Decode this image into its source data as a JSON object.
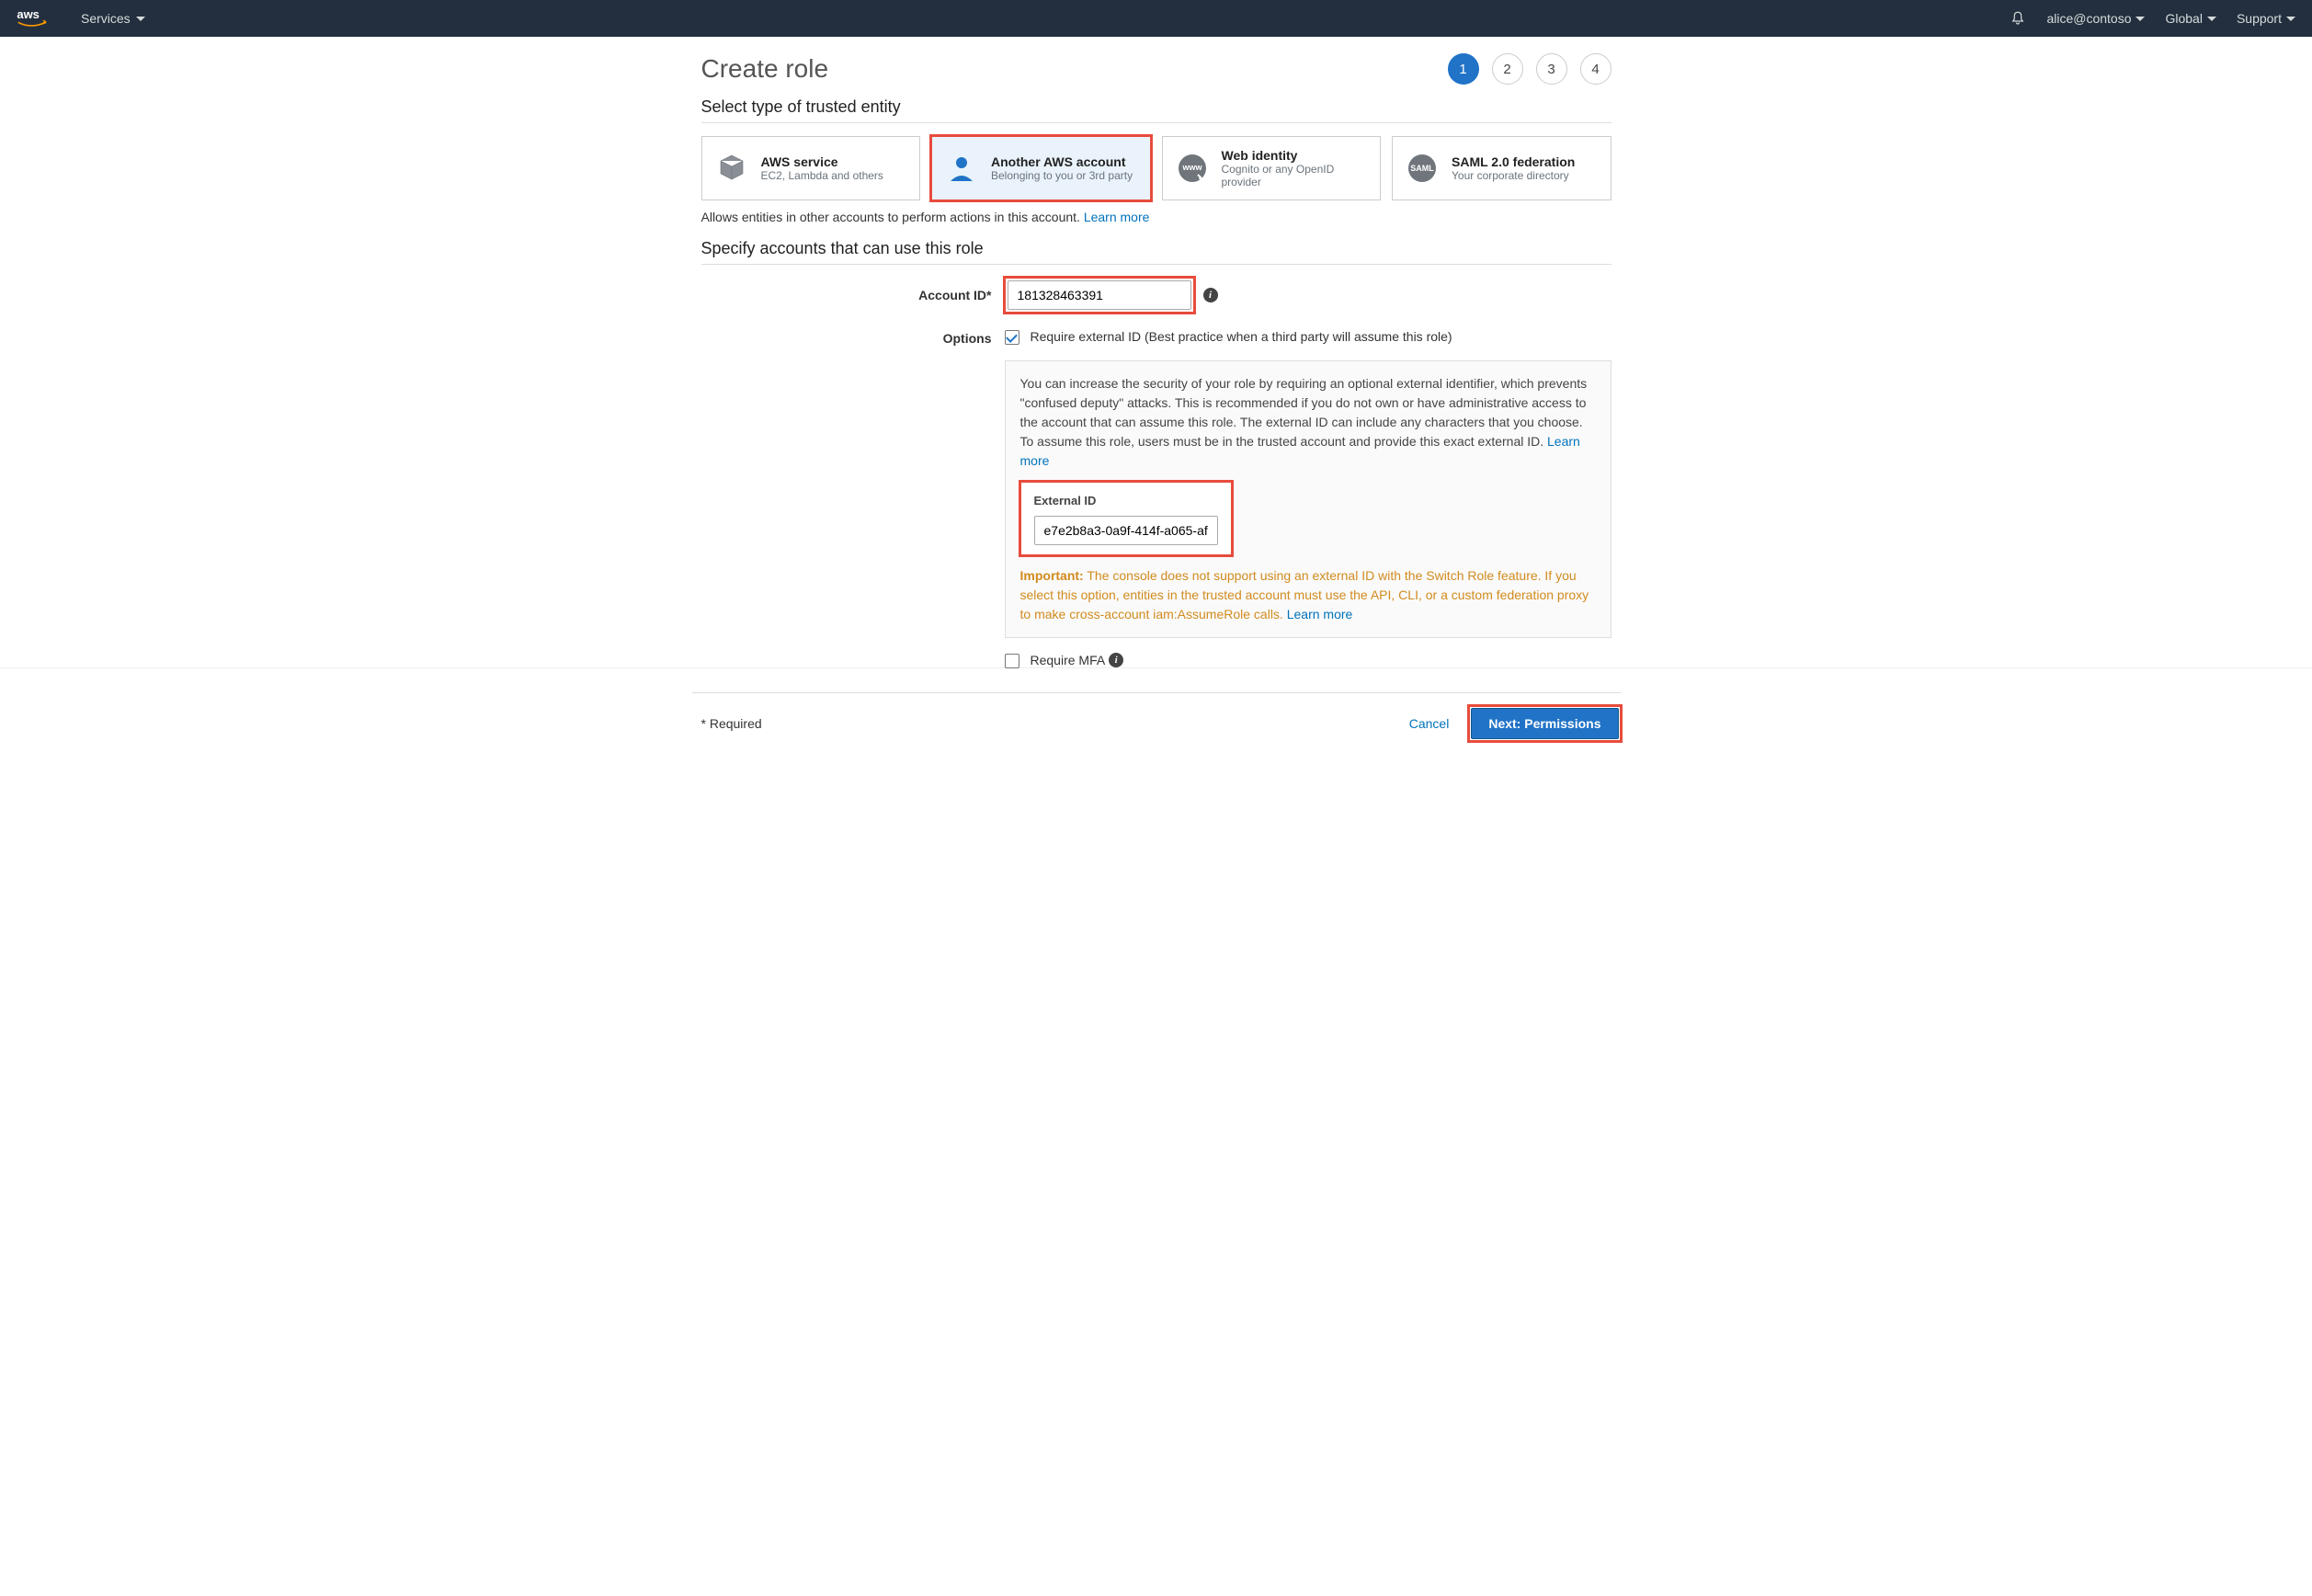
{
  "topbar": {
    "services_label": "Services",
    "user_label": "alice@contoso",
    "region_label": "Global",
    "support_label": "Support"
  },
  "page": {
    "title": "Create role",
    "steps": [
      "1",
      "2",
      "3",
      "4"
    ],
    "active_step_index": 0,
    "section_trusted_entity": "Select type of trusted entity",
    "entities": [
      {
        "title": "AWS service",
        "sub": "EC2, Lambda and others",
        "icon": "cube"
      },
      {
        "title": "Another AWS account",
        "sub": "Belonging to you or 3rd party",
        "icon": "person",
        "selected": true
      },
      {
        "title": "Web identity",
        "sub": "Cognito or any OpenID provider",
        "icon": "www"
      },
      {
        "title": "SAML 2.0 federation",
        "sub": "Your corporate directory",
        "icon": "saml"
      }
    ],
    "entity_desc": "Allows entities in other accounts to perform actions in this account. ",
    "learn_more": "Learn more",
    "section_specify": "Specify accounts that can use this role",
    "account_id_label": "Account ID*",
    "account_id_value": "181328463391",
    "options_label": "Options",
    "require_external_id_label": "Require external ID (Best practice when a third party will assume this role)",
    "require_external_id_checked": true,
    "info_text": "You can increase the security of your role by requiring an optional external identifier, which prevents \"confused deputy\" attacks. This is recommended if you do not own or have administrative access to the account that can assume this role. The external ID can include any characters that you choose. To assume this role, users must be in the trusted account and provide this exact external ID. ",
    "external_id_label": "External ID",
    "external_id_value": "e7e2b8a3-0a9f-414f-a065-af",
    "important_label": "Important:",
    "important_text": " The console does not support using an external ID with the Switch Role feature. If you select this option, entities in the trusted account must use the API, CLI, or a custom federation proxy to make cross-account iam:AssumeRole calls. ",
    "require_mfa_label": "Require MFA",
    "require_mfa_checked": false
  },
  "footer": {
    "required_note": "* Required",
    "cancel": "Cancel",
    "next": "Next: Permissions"
  }
}
